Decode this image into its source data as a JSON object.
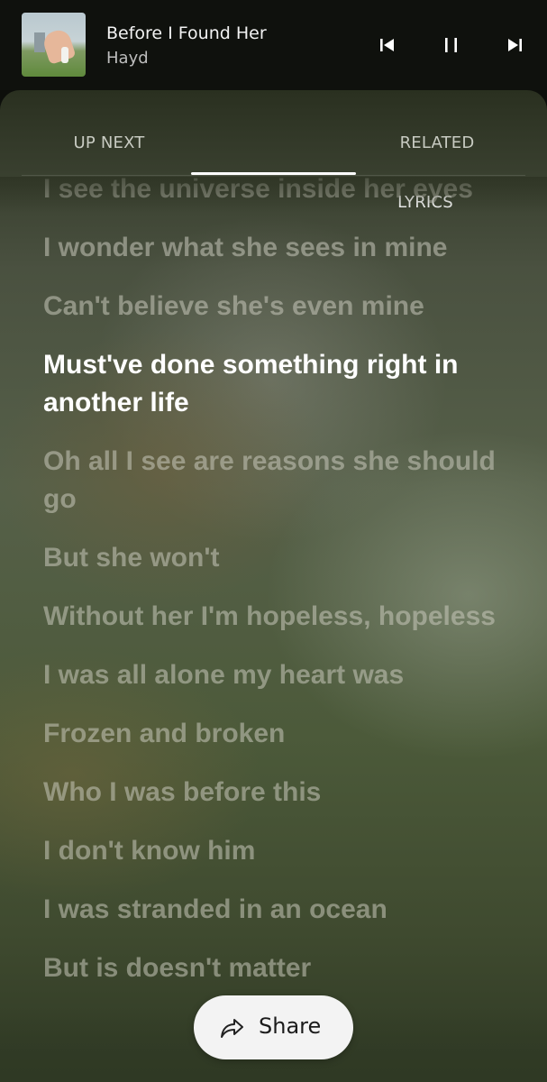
{
  "now_playing": {
    "title": "Before I Found Her",
    "artist": "Hayd",
    "state": "playing"
  },
  "controls": {
    "previous_icon": "skip-previous-icon",
    "pause_icon": "pause-icon",
    "next_icon": "skip-next-icon"
  },
  "tabs": [
    {
      "label": "UP NEXT",
      "selected": false
    },
    {
      "label": "LYRICS",
      "selected": true
    },
    {
      "label": "RELATED",
      "selected": false
    }
  ],
  "lyrics": {
    "active_index": 3,
    "lines": [
      "I see the universe inside her eyes",
      "I wonder what she sees in mine",
      "Can't believe she's even mine",
      "Must've done something right in another life",
      "Oh all I see are reasons she should go",
      "But she won't",
      "Without her I'm hopeless, hopeless",
      "I was all alone my heart was",
      "Frozen and broken",
      "Who I was before this",
      "I don't know him",
      "I was stranded in an ocean",
      "But is doesn't matter"
    ]
  },
  "share": {
    "label": "Share",
    "icon": "share-arrow-icon"
  },
  "colors": {
    "active_lyric": "#ffffff",
    "inactive_lyric": "#c8c8bc",
    "tab_indicator": "#ffffff",
    "share_button_bg": "#f3f3f3"
  }
}
